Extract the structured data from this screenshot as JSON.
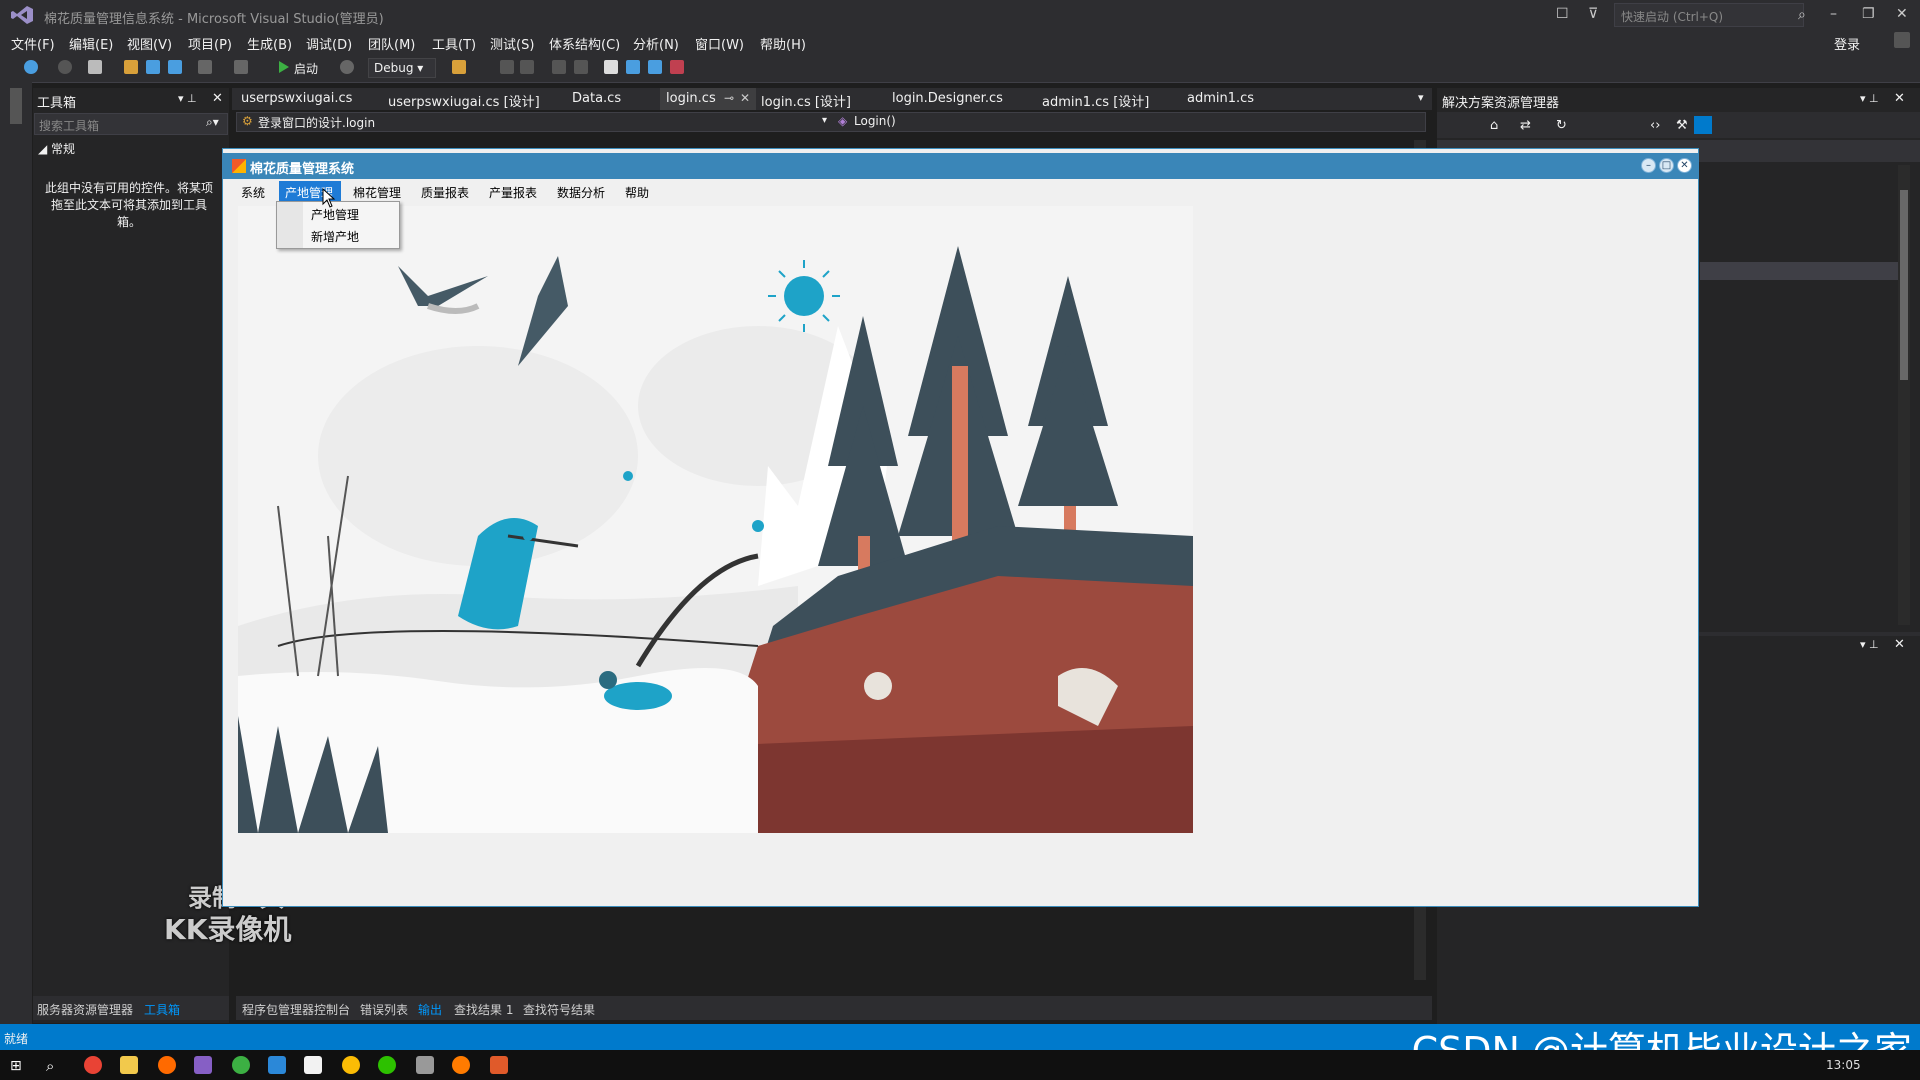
{
  "window": {
    "title": "棉花质量管理信息系统 - Microsoft Visual Studio(管理员)",
    "quick_launch": "快速启动 (Ctrl+Q)",
    "login": "登录"
  },
  "menu": [
    "文件(F)",
    "编辑(E)",
    "视图(V)",
    "项目(P)",
    "生成(B)",
    "调试(D)",
    "团队(M)",
    "工具(T)",
    "测试(S)",
    "体系结构(C)",
    "分析(N)",
    "窗口(W)",
    "帮助(H)"
  ],
  "toolbar": {
    "start": "启动",
    "config": "Debug"
  },
  "toolbox": {
    "title": "工具箱",
    "search_placeholder": "搜索工具箱",
    "group": "常规",
    "empty_message": "此组中没有可用的控件。将某项拖至此文本可将其添加到工具箱。"
  },
  "tabs": [
    "userpswxiugai.cs",
    "userpswxiugai.cs [设计]",
    "Data.cs",
    "login.cs",
    "login.cs [设计]",
    "login.Designer.cs",
    "admin1.cs [设计]",
    "admin1.cs"
  ],
  "nav": {
    "left": "登录窗口的设计.login",
    "right": "Login()"
  },
  "solution_explorer": {
    "title": "解决方案资源管理器"
  },
  "output_tabs": [
    "程序包管理器控制台",
    "错误列表",
    "输出",
    "查找结果 1",
    "查找符号结果"
  ],
  "bottom_left_tabs": [
    "服务器资源管理器",
    "工具箱"
  ],
  "status": {
    "text": "就绪"
  },
  "recorder": {
    "line1": "录制工具",
    "line2": "KK录像机"
  },
  "watermark": "CSDN @计算机毕业设计之家",
  "clock": "13:05",
  "form": {
    "title": "棉花质量管理系统",
    "menu": [
      "系统",
      "产地管理",
      "棉花管理",
      "质量报表",
      "产量报表",
      "数据分析",
      "帮助"
    ],
    "dropdown": [
      "产地管理",
      "新增产地"
    ]
  },
  "colors": {
    "vs_dark": "#2d2d30",
    "status_blue": "#007acc",
    "form_title": "#3a86b8",
    "menu_highlight": "#1e7bd6"
  }
}
